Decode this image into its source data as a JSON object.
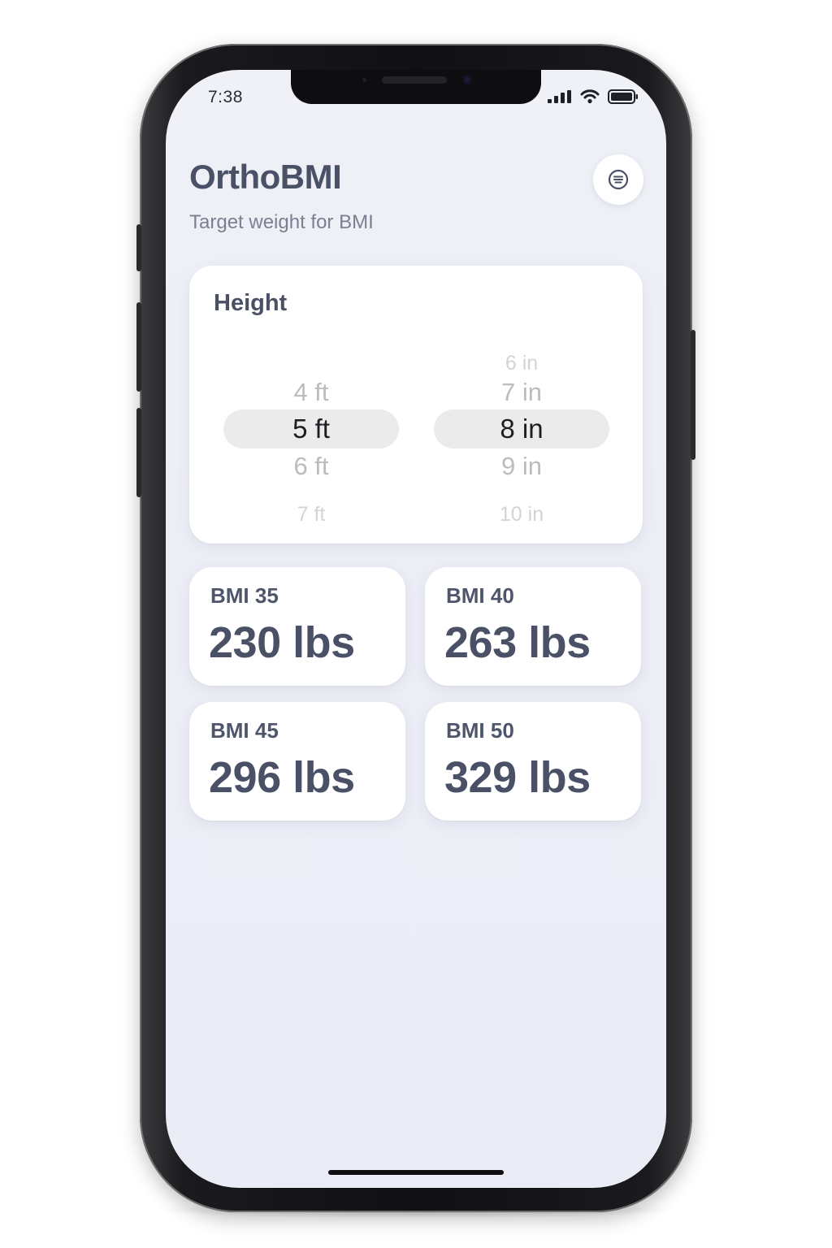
{
  "status_bar": {
    "time": "7:38"
  },
  "header": {
    "title": "OrthoBMI",
    "subtitle": "Target weight for BMI",
    "menu_icon": "filter-lines-icon"
  },
  "height_card": {
    "label": "Height",
    "feet_options": [
      "4 ft",
      "5 ft",
      "6 ft",
      "7 ft"
    ],
    "feet_selected": "5 ft",
    "inch_options": [
      "6 in",
      "7 in",
      "8 in",
      "9 in",
      "10 in"
    ],
    "inch_selected": "8 in"
  },
  "results": [
    {
      "bmi_label": "BMI 35",
      "weight": "230 lbs"
    },
    {
      "bmi_label": "BMI 40",
      "weight": "263 lbs"
    },
    {
      "bmi_label": "BMI 45",
      "weight": "296 lbs"
    },
    {
      "bmi_label": "BMI 50",
      "weight": "329 lbs"
    }
  ],
  "colors": {
    "title": "#4a5166",
    "background": "#eff1f7",
    "card": "#ffffff",
    "selection_band": "#ebebeb"
  }
}
